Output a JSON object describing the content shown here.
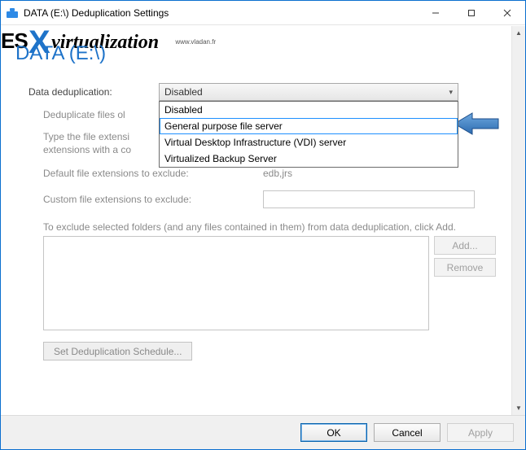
{
  "window": {
    "title": "DATA (E:\\) Deduplication Settings"
  },
  "watermark": {
    "es": "ES",
    "x": "X",
    "virt": "virtualization",
    "url": "www.vladan.fr"
  },
  "heading": "DATA (E:\\)",
  "labels": {
    "dedup": "Data deduplication:",
    "dedup_files_older": "Deduplicate files ol",
    "type_ext_line1": "Type the file extensi",
    "type_ext_line2": "extensions with a co",
    "default_ext_label": "Default file extensions to exclude:",
    "default_ext_value": "edb,jrs",
    "custom_ext_label": "Custom file extensions to exclude:",
    "exclude_note": "To exclude selected folders (and any files contained in them) from data deduplication, click Add."
  },
  "dropdown": {
    "selected": "Disabled",
    "options": [
      "Disabled",
      "General purpose file server",
      "Virtual Desktop Infrastructure (VDI) server",
      "Virtualized Backup Server"
    ],
    "highlight_index": 1
  },
  "custom_ext_value": "",
  "buttons": {
    "add": "Add...",
    "remove": "Remove",
    "schedule": "Set Deduplication Schedule...",
    "ok": "OK",
    "cancel": "Cancel",
    "apply": "Apply"
  }
}
